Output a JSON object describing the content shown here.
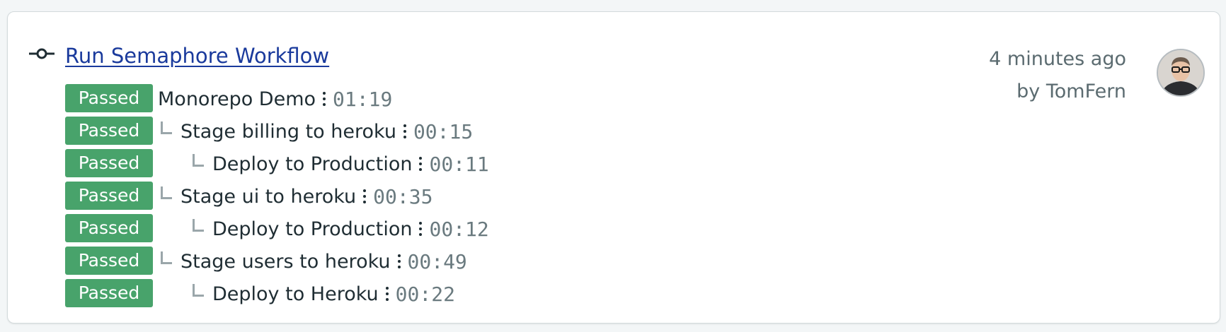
{
  "workflow": {
    "title": "Run Semaphore Workflow",
    "time_ago": "4 minutes ago",
    "author": "by TomFern",
    "avatar_icon": "user-avatar",
    "status_color": "#48a36b",
    "link_color": "#1a3a9c"
  },
  "pipelines": [
    {
      "status": "Passed",
      "name": "Monorepo Demo",
      "duration": "01:19",
      "level": 0
    },
    {
      "status": "Passed",
      "name": "Stage billing to heroku",
      "duration": "00:15",
      "level": 1
    },
    {
      "status": "Passed",
      "name": "Deploy to Production",
      "duration": "00:11",
      "level": 2
    },
    {
      "status": "Passed",
      "name": "Stage ui to heroku",
      "duration": "00:35",
      "level": 1
    },
    {
      "status": "Passed",
      "name": "Deploy to Production",
      "duration": "00:12",
      "level": 2
    },
    {
      "status": "Passed",
      "name": "Stage users to heroku",
      "duration": "00:49",
      "level": 1
    },
    {
      "status": "Passed",
      "name": "Deploy to Heroku",
      "duration": "00:22",
      "level": 2
    }
  ]
}
